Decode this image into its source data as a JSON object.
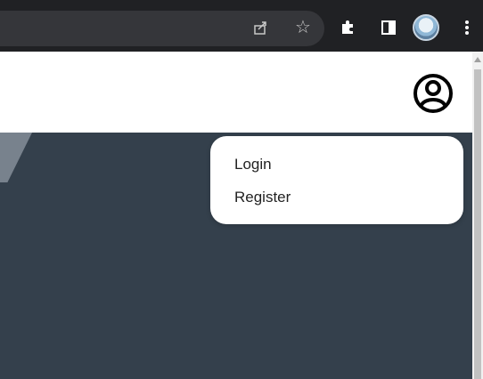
{
  "browser": {
    "toolbar_icons": [
      "share-icon",
      "star-icon",
      "puzzle-icon",
      "sidepanel-icon",
      "profile-avatar",
      "kebab-icon"
    ]
  },
  "page": {
    "header": {
      "account_icon": "account-circle-icon"
    },
    "dropdown": {
      "items": [
        {
          "label": "Login"
        },
        {
          "label": "Register"
        }
      ]
    }
  },
  "colors": {
    "toolbar_bg": "#202124",
    "omnibox_bg": "#35363a",
    "hero_bg": "#34404c",
    "dropdown_bg": "#ffffff"
  }
}
